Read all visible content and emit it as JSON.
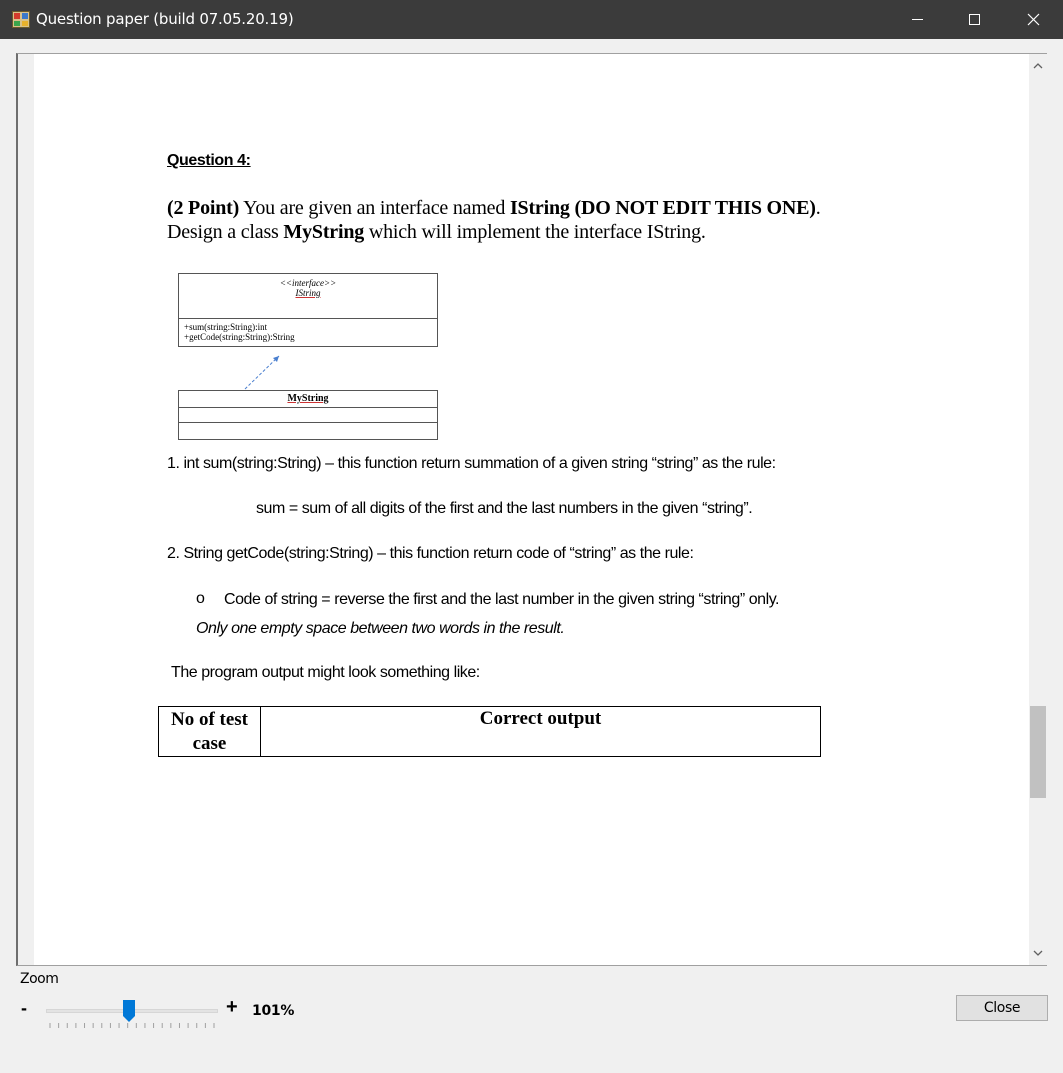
{
  "window": {
    "title": "Question paper (build 07.05.20.19)",
    "icons": {
      "app": "app-icon",
      "minimize": "minimize-icon",
      "maximize": "maximize-icon",
      "close": "close-icon"
    }
  },
  "document": {
    "heading": "Question 4:",
    "intro": {
      "points": "(2 Point)",
      "t1": " You are given an interface named ",
      "iface": "IString",
      "t2": " ",
      "dont_edit": "(DO NOT EDIT THIS ONE)",
      "t3": ".",
      "t4": "Design a class ",
      "cls": "MyString",
      "t5": " which will implement the interface IString."
    },
    "uml": {
      "stereotype": "<<interface>>",
      "interface_name": "IString",
      "methods": [
        "+sum(string:String):int",
        "+getCode(string:String):String"
      ],
      "class_name": "MyString"
    },
    "item1": "1. int sum(string:String) – this function return summation of a given string “string” as the rule:",
    "rule1": "sum = sum of all digits of the first and the last numbers in the given “string”.",
    "item2": "2. String getCode(string:String) – this function return code of “string” as the rule:",
    "bullet_mark": "o",
    "bullet": "Code of string =  reverse the first and the last number in the given string “string” only.",
    "bullet_note": "Only one empty space between two words in the result.",
    "output_intro": "The program output might look something like:",
    "table": {
      "col1": "No of test case",
      "col2": "Correct output"
    }
  },
  "zoom": {
    "label": "Zoom",
    "minus": "-",
    "plus": "+",
    "value_text": "101%",
    "value": 101,
    "min": 10,
    "max": 200
  },
  "buttons": {
    "close": "Close"
  },
  "scroll": {
    "position_fraction": 0.72
  }
}
